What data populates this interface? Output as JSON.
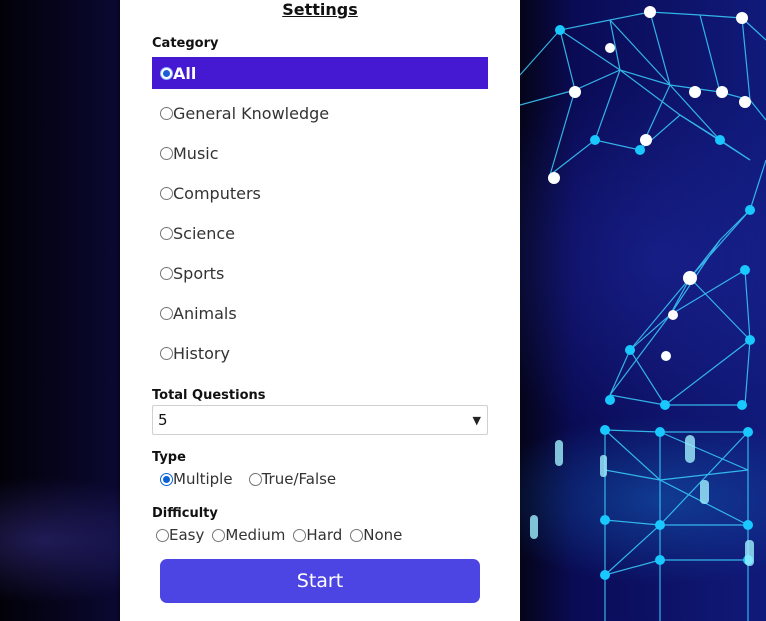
{
  "settings": {
    "title": "Settings",
    "category_label": "Category",
    "categories": [
      {
        "label": "All",
        "selected": true
      },
      {
        "label": "General Knowledge",
        "selected": false
      },
      {
        "label": "Music",
        "selected": false
      },
      {
        "label": "Computers",
        "selected": false
      },
      {
        "label": "Science",
        "selected": false
      },
      {
        "label": "Sports",
        "selected": false
      },
      {
        "label": "Animals",
        "selected": false
      },
      {
        "label": "History",
        "selected": false
      }
    ],
    "total_questions_label": "Total Questions",
    "total_questions_value": "5",
    "type_label": "Type",
    "types": [
      {
        "label": "Multiple",
        "selected": true
      },
      {
        "label": "True/False",
        "selected": false
      }
    ],
    "difficulty_label": "Difficulty",
    "difficulties": [
      {
        "label": "Easy",
        "selected": false
      },
      {
        "label": "Medium",
        "selected": false
      },
      {
        "label": "Hard",
        "selected": false
      },
      {
        "label": "None",
        "selected": false
      }
    ],
    "start_label": "Start"
  },
  "colors": {
    "selected_category_bg": "#4419d1",
    "start_button_bg": "#4c45e3",
    "radio_checked": "#0b62d6"
  },
  "icons": {
    "select_arrow": "chevron-down-icon"
  }
}
